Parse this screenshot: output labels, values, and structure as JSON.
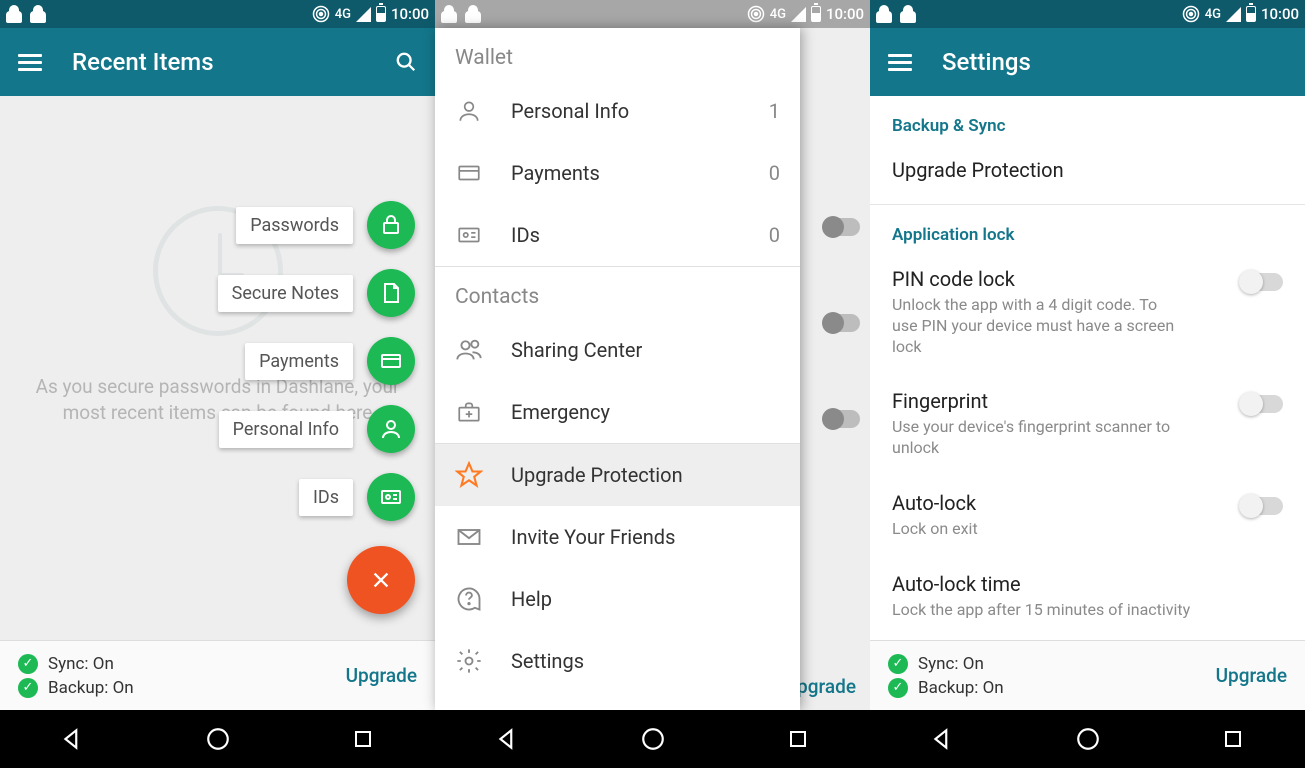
{
  "status": {
    "network": "4G",
    "time": "10:00"
  },
  "phone1": {
    "title": "Recent Items",
    "empty_text": "As you secure passwords in Dashlane, your most recent items can be found here",
    "fab": {
      "passwords": "Passwords",
      "secure_notes": "Secure Notes",
      "payments": "Payments",
      "personal_info": "Personal Info",
      "ids": "IDs"
    },
    "sync": "Sync: On",
    "backup": "Backup: On",
    "upgrade": "Upgrade"
  },
  "phone2": {
    "wallet_header": "Wallet",
    "personal_info": {
      "label": "Personal Info",
      "count": "1"
    },
    "payments": {
      "label": "Payments",
      "count": "0"
    },
    "ids": {
      "label": "IDs",
      "count": "0"
    },
    "contacts_header": "Contacts",
    "sharing": "Sharing Center",
    "emergency": "Emergency",
    "upgrade_protection": "Upgrade Protection",
    "invite": "Invite Your Friends",
    "help": "Help",
    "settings": "Settings",
    "bg_upgrade": "Upgrade"
  },
  "phone3": {
    "title": "Settings",
    "backup_sync_header": "Backup & Sync",
    "upgrade_protection": "Upgrade Protection",
    "app_lock_header": "Application lock",
    "pin": {
      "title": "PIN code lock",
      "sub": "Unlock the app with a 4 digit code. To use PIN your device must have a screen lock"
    },
    "fingerprint": {
      "title": "Fingerprint",
      "sub": "Use your device's fingerprint scanner to unlock"
    },
    "autolock": {
      "title": "Auto-lock",
      "sub": "Lock on exit"
    },
    "autolock_time": {
      "title": "Auto-lock time",
      "sub": "Lock the app after 15 minutes of inactivity"
    },
    "sync": "Sync: On",
    "backup": "Backup: On",
    "upgrade": "Upgrade"
  }
}
